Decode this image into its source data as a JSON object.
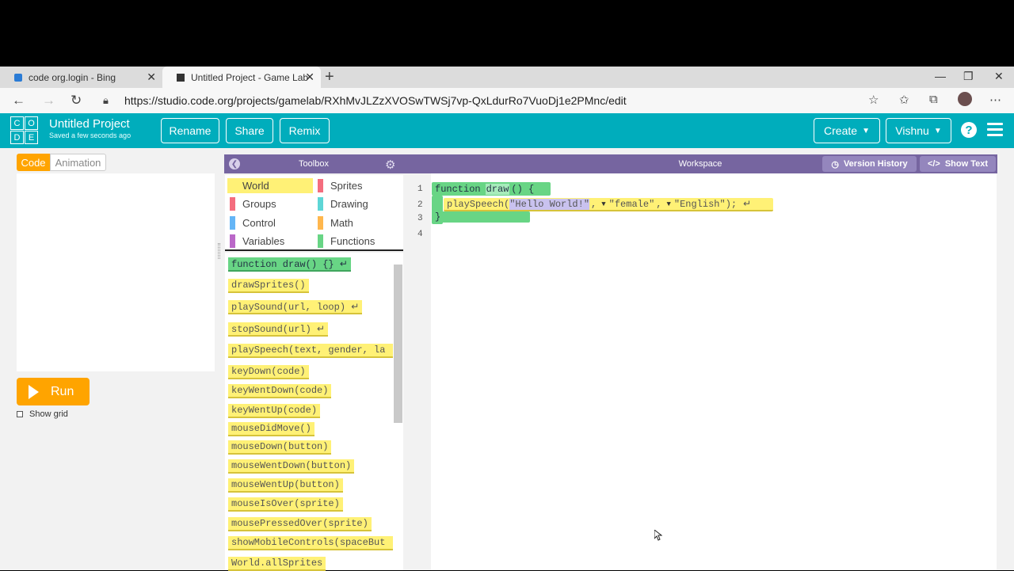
{
  "browser": {
    "tabs": [
      {
        "title": "code org.login - Bing"
      },
      {
        "title": "Untitled Project - Game Lab"
      }
    ],
    "url": "https://studio.code.org/projects/gamelab/RXhMvJLZzXVOSwTWSj7vp-QxLdurRo7VuoDj1e2PMnc/edit"
  },
  "header": {
    "logo_letters": [
      "C",
      "O",
      "D",
      "E"
    ],
    "project_title": "Untitled Project",
    "saved_status": "Saved a few seconds ago",
    "buttons": {
      "rename": "Rename",
      "share": "Share",
      "remix": "Remix",
      "create": "Create",
      "user": "Vishnu"
    },
    "help": "?"
  },
  "left": {
    "tab_code": "Code",
    "tab_animation": "Animation",
    "run_label": "Run",
    "show_grid_label": "Show grid"
  },
  "toolbox": {
    "title": "Toolbox",
    "categories": [
      {
        "label": "World",
        "color": "#fff176"
      },
      {
        "label": "Sprites",
        "color": "#f46d7e"
      },
      {
        "label": "Groups",
        "color": "#f46d7e"
      },
      {
        "label": "Drawing",
        "color": "#5ed6d6"
      },
      {
        "label": "Control",
        "color": "#64b5f6"
      },
      {
        "label": "Math",
        "color": "#ffb74d"
      },
      {
        "label": "Variables",
        "color": "#ba68c8"
      },
      {
        "label": "Functions",
        "color": "#68d585"
      }
    ],
    "blocks": [
      "function draw() {} ↵",
      "drawSprites()",
      "playSound(url, loop) ↵",
      "stopSound(url) ↵",
      "playSpeech(text, gender, la",
      "keyDown(code)",
      "keyWentDown(code)",
      "keyWentUp(code)",
      "mouseDidMove()",
      "mouseDown(button)",
      "mouseWentDown(button)",
      "mouseWentUp(button)",
      "mouseIsOver(sprite)",
      "mousePressedOver(sprite)",
      "showMobileControls(spaceBut",
      "World.allSprites"
    ]
  },
  "workspace": {
    "title": "Workspace",
    "version_history": "Version History",
    "show_text": "Show Text",
    "line_numbers": [
      "1",
      "2",
      "3",
      "4"
    ],
    "code": {
      "fn_keyword": "function",
      "fn_name": "draw",
      "fn_parens": "() {",
      "call_name": "playSpeech(",
      "arg_text": "\"Hello World!\"",
      "arg_gender": "\"female\"",
      "arg_lang": "\"English\"",
      "call_end": ");",
      "close_brace": "}"
    }
  }
}
